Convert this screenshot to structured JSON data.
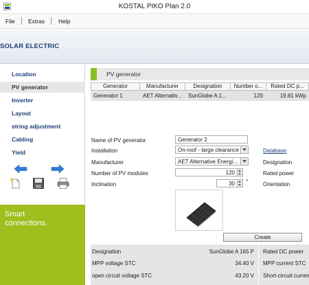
{
  "window": {
    "title": "KOSTAL PIKO Plan 2.0"
  },
  "menu": {
    "items": [
      "File",
      "Extras",
      "Help"
    ]
  },
  "brand": {
    "name": "SOLAR ELECTRIC"
  },
  "sidebar": {
    "items": [
      "Location",
      "PV generator",
      "Inverter",
      "Layout",
      "string adjustment",
      "Cabling",
      "Yield"
    ],
    "active": "PV generator",
    "toolbar_icons": [
      "back-arrow-icon",
      "forward-arrow-icon",
      "new-document-icon",
      "save-disk-icon",
      "print-icon"
    ]
  },
  "promo": {
    "line1": "Smart",
    "line2": "connections."
  },
  "main": {
    "section_title": "PV generator",
    "table": {
      "columns": [
        "Generator",
        "Manufacturer",
        "Designation",
        "Number o...",
        "Rated DC p..."
      ],
      "rows": [
        [
          "Generator 1",
          "AET Alternativ...",
          "SunGlobe A 1...",
          "120",
          "19.81 kWp"
        ]
      ]
    },
    "form": {
      "name_label": "Name of PV generator",
      "name_value": "Generator 2",
      "installation_label": "Installation",
      "installation_value": "On-roof - large clearance",
      "manufacturer_label": "Manufacturer",
      "manufacturer_value": "AET Alternative Energi...",
      "modules_label": "Number of PV modules",
      "modules_value": "120",
      "inclination_label": "Inclination",
      "inclination_value": "30",
      "inclination_unit": "°",
      "database_link": "Database",
      "designation_label": "Designation",
      "rated_power_label": "Rated power",
      "orientation_label": "Orientation"
    },
    "create_button": "Create",
    "details": {
      "designation_label": "Designation",
      "designation_value": "SunGlobe A 165 P",
      "mpp_voltage_label": "MPP voltage STC",
      "mpp_voltage_value": "34.40 V",
      "ocv_label": "open circuit voltage STC",
      "ocv_value": "43.20 V",
      "rated_dc_label": "Rated DC power",
      "mpp_current_label": "MPP current STC",
      "short_circuit_label": "Short-circuit curren"
    }
  },
  "colors": {
    "accent_green": "#9fbf1f",
    "brand_blue": "#1d3f75"
  }
}
